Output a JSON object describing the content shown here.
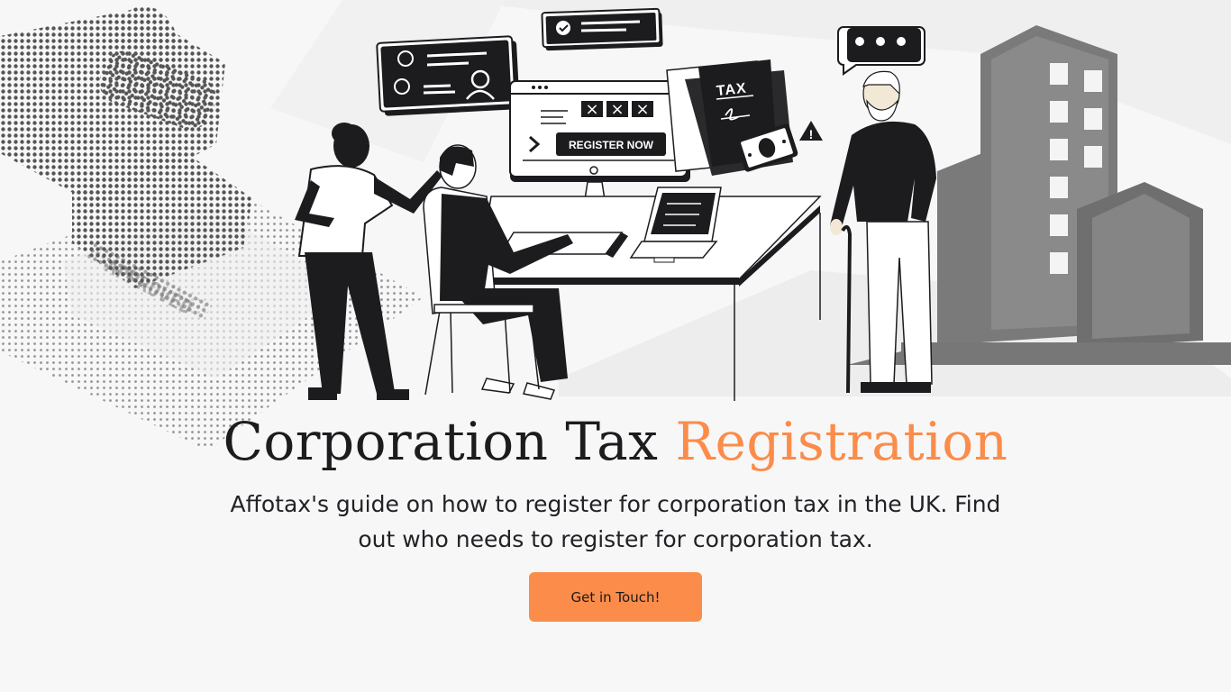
{
  "hero": {
    "illustration": {
      "register_button_label": "REGISTER NOW",
      "tax_document_label": "TAX",
      "captcha_marks": [
        "×",
        "×",
        "×"
      ],
      "warning_symbol": "!",
      "stamp_text": "APPROVED",
      "icons": [
        "stamp-icon",
        "id-card-icon",
        "checkmark-icon",
        "chat-bubble-icon",
        "warning-icon",
        "banknote-icon",
        "building-icon"
      ]
    },
    "title_main": "Corporation Tax",
    "title_accent": "Registration",
    "subtitle": "Affotax's guide on how to register for corporation tax in the UK. Find out who needs to register for corporation tax.",
    "cta_label": "Get in Touch!"
  },
  "colors": {
    "accent": "#fb8c4a",
    "dark": "#1c1c1f",
    "background": "#f7f7f8",
    "building": "#7a7a7a"
  }
}
